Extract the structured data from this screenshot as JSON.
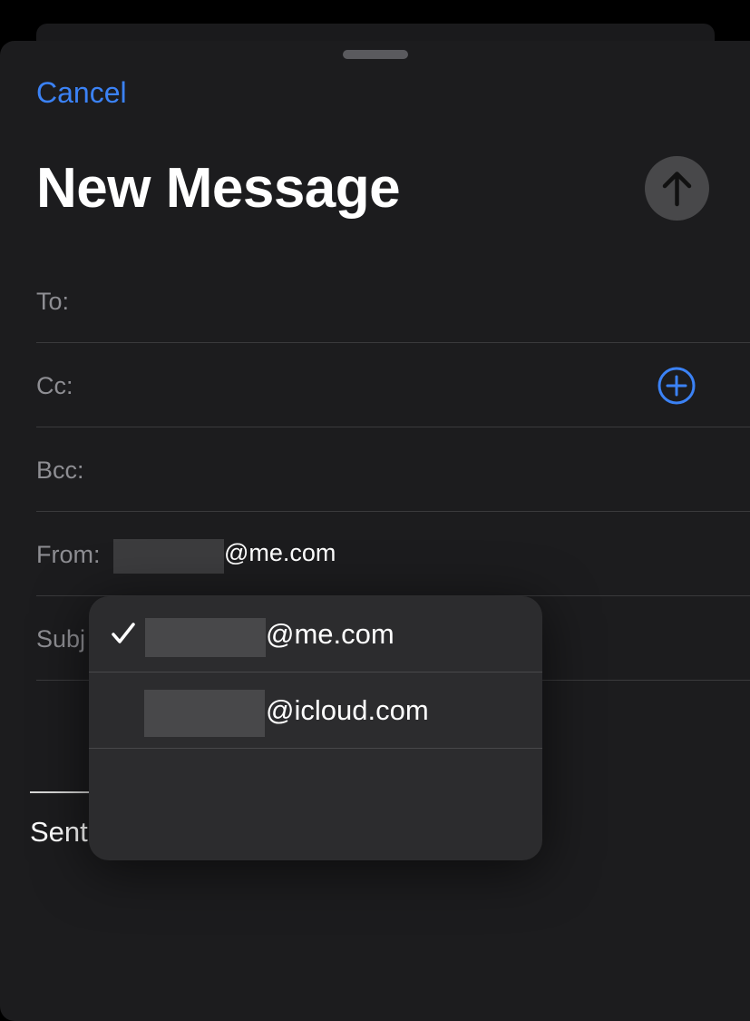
{
  "header": {
    "cancel_label": "Cancel",
    "title": "New Message",
    "send_icon": "arrow-up-icon"
  },
  "fields": {
    "to_label": "To:",
    "cc_label": "Cc:",
    "bcc_label": "Bcc:",
    "from_label": "From:",
    "from_domain": "@me.com",
    "subject_label": "Subj",
    "add_icon": "plus-circle-icon"
  },
  "body_preview": {
    "text": "Sent"
  },
  "from_menu": {
    "items": [
      {
        "domain": "@me.com",
        "selected": true
      },
      {
        "domain": "@icloud.com",
        "selected": false
      }
    ]
  },
  "colors": {
    "accent": "#3b82f6",
    "background": "#1c1c1e",
    "menu_background": "#2c2c2e",
    "label": "#8e8e93"
  }
}
